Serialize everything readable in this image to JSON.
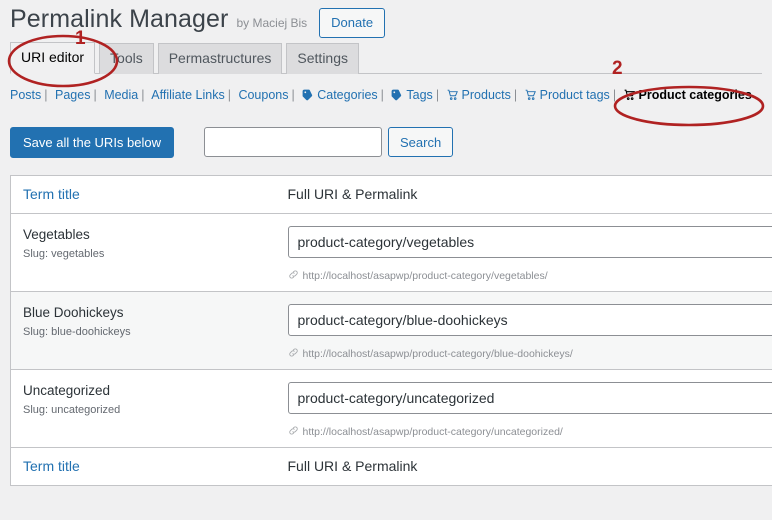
{
  "header": {
    "title": "Permalink Manager",
    "author": "by Maciej Bis",
    "donate_label": "Donate"
  },
  "tabs": [
    {
      "label": "URI editor",
      "active": true
    },
    {
      "label": "Tools",
      "active": false
    },
    {
      "label": "Permastructures",
      "active": false
    },
    {
      "label": "Settings",
      "active": false
    }
  ],
  "subnav": [
    {
      "label": "Posts",
      "icon": "none",
      "current": false
    },
    {
      "label": "Pages",
      "icon": "none",
      "current": false
    },
    {
      "label": "Media",
      "icon": "none",
      "current": false
    },
    {
      "label": "Affiliate Links",
      "icon": "none",
      "current": false
    },
    {
      "label": "Coupons",
      "icon": "none",
      "current": false
    },
    {
      "label": "Categories",
      "icon": "tag-icon",
      "current": false
    },
    {
      "label": "Tags",
      "icon": "tag-icon",
      "current": false
    },
    {
      "label": "Products",
      "icon": "cart-icon",
      "current": false
    },
    {
      "label": "Product tags",
      "icon": "cart-icon",
      "current": false
    },
    {
      "label": "Product categories",
      "icon": "cart-icon",
      "current": true
    }
  ],
  "actions": {
    "save_label": "Save all the URIs below",
    "search_value": "",
    "search_placeholder": "",
    "search_button": "Search"
  },
  "table": {
    "col_term_title": "Term title",
    "col_full_uri": "Full URI & Permalink",
    "slug_prefix": "Slug: ",
    "rows": [
      {
        "title": "Vegetables",
        "slug": "vegetables",
        "uri": "product-category/vegetables",
        "permalink": "http://localhost/asapwp/product-category/vegetables/"
      },
      {
        "title": "Blue Doohickeys",
        "slug": "blue-doohickeys",
        "uri": "product-category/blue-doohickeys",
        "permalink": "http://localhost/asapwp/product-category/blue-doohickeys/"
      },
      {
        "title": "Uncategorized",
        "slug": "uncategorized",
        "uri": "product-category/uncategorized",
        "permalink": "http://localhost/asapwp/product-category/uncategorized/"
      }
    ]
  },
  "annotations": [
    {
      "label": "1",
      "target": "uri-editor-tab"
    },
    {
      "label": "2",
      "target": "product-categories-link"
    }
  ],
  "colors": {
    "accent_blue": "#2271b1",
    "annotation_red": "#b02222",
    "page_bg": "#f0f0f1",
    "tab_bg": "#dcdcde"
  }
}
